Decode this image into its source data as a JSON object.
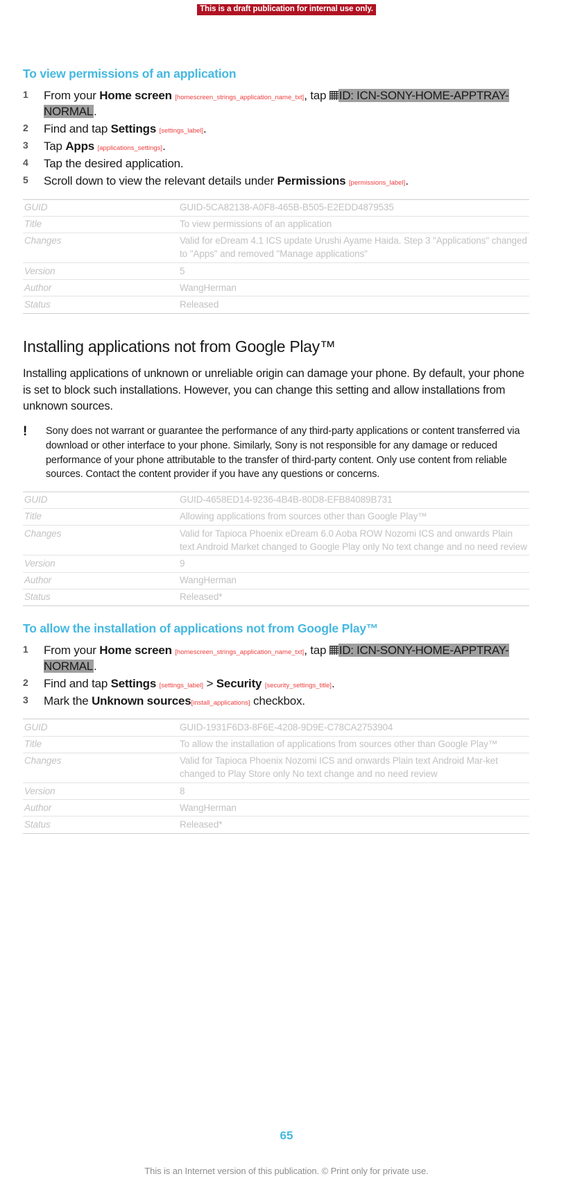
{
  "banner": {
    "draft_notice": "This is a draft publication for internal use only."
  },
  "sections": [
    {
      "heading": "To view permissions of an application",
      "steps": [
        {
          "num": "1",
          "prefix": "From your ",
          "bold1": "Home screen",
          "strid1": "[homescreen_strings_application_name_txt]",
          "mid": ", tap ",
          "icon": "grid-icon",
          "icn_text": "ID: ICN-SONY-HOME-APPTRAY-NORMAL",
          "suffix": "."
        },
        {
          "num": "2",
          "prefix": "Find and tap ",
          "bold1": "Settings",
          "strid1": "[settings_label]",
          "suffix": "."
        },
        {
          "num": "3",
          "prefix": "Tap ",
          "bold1": "Apps",
          "strid1": "[applications_settings]",
          "suffix": "."
        },
        {
          "num": "4",
          "prefix": "Tap the desired application.",
          "bold1": "",
          "strid1": "",
          "suffix": ""
        },
        {
          "num": "5",
          "prefix": "Scroll down to view the relevant details under ",
          "bold1": "Permissions",
          "strid1": "[permissions_label]",
          "suffix": "."
        }
      ],
      "table": {
        "rows": [
          {
            "key": "GUID",
            "value": "GUID-5CA82138-A0F8-465B-B505-E2EDD4879535"
          },
          {
            "key": "Title",
            "value": "To view permissions of an application"
          },
          {
            "key": "Changes",
            "value": "Valid for eDream 4.1 ICS update Urushi Ayame Haida. Step 3 \"Applications\" changed to \"Apps\" and removed \"Manage applications\""
          },
          {
            "key": "Version",
            "value": "5"
          },
          {
            "key": "Author",
            "value": "WangHerman"
          },
          {
            "key": "Status",
            "value": "Released"
          }
        ]
      }
    },
    {
      "main_heading": "Installing applications not from Google Play™",
      "paragraph": "Installing applications of unknown or unreliable origin can damage your phone. By default, your phone is set to block such installations. However, you can change this setting and allow installations from unknown sources.",
      "note": {
        "icon": "exclamation-icon",
        "text": "Sony does not warrant or guarantee the performance of any third-party applications or content transferred via download or other interface to your phone. Similarly, Sony is not responsible for any damage or reduced performance of your phone attributable to the transfer of third-party content. Only use content from reliable sources. Contact the content provider if you have any questions or concerns."
      },
      "table": {
        "rows": [
          {
            "key": "GUID",
            "value": "GUID-4658ED14-9236-4B4B-80D8-EFB84089B731"
          },
          {
            "key": "Title",
            "value": "Allowing applications from sources other than Google Play™"
          },
          {
            "key": "Changes",
            "value": "Valid for Tapioca Phoenix eDream 6.0 Aoba ROW Nozomi ICS and onwards Plain text Android Market changed to Google Play only No text change and no need review"
          },
          {
            "key": "Version",
            "value": "9"
          },
          {
            "key": "Author",
            "value": "WangHerman"
          },
          {
            "key": "Status",
            "value": "Released*"
          }
        ]
      }
    },
    {
      "heading": "To allow the installation of applications not from Google Play™",
      "steps": [
        {
          "num": "1",
          "prefix": "From your ",
          "bold1": "Home screen",
          "strid1": "[homescreen_strings_application_name_txt]",
          "mid": ", tap ",
          "icon": "grid-icon",
          "icn_text": "ID: ICN-SONY-HOME-APPTRAY-NORMAL",
          "suffix": "."
        },
        {
          "num": "2",
          "prefix": "Find and tap ",
          "bold1": "Settings",
          "strid1": "[settings_label]",
          "mid": " > ",
          "bold2": "Security",
          "strid2": "[security_settings_title]",
          "suffix": "."
        },
        {
          "num": "3",
          "prefix": "Mark the ",
          "bold1": "Unknown sources",
          "strid1": "[install_applications]",
          "suffix": " checkbox."
        }
      ],
      "table": {
        "rows": [
          {
            "key": "GUID",
            "value": "GUID-1931F6D3-8F6E-4208-9D9E-C78CA2753904"
          },
          {
            "key": "Title",
            "value": "To allow the installation of applications from sources other than Google Play™"
          },
          {
            "key": "Changes",
            "value": "Valid for Tapioca Phoenix Nozomi ICS and onwards Plain text Android Mar-ket changed to Play Store only No text change and no need review"
          },
          {
            "key": "Version",
            "value": "8"
          },
          {
            "key": "Author",
            "value": "WangHerman"
          },
          {
            "key": "Status",
            "value": "Released*"
          }
        ]
      }
    }
  ],
  "footer": {
    "page_number": "65",
    "notice": "This is an Internet version of this publication. © Print only for private use."
  },
  "colors": {
    "heading_blue": "#45b8e0",
    "draft_red": "#b01222",
    "string_id_red": "#ef3e3e",
    "table_text_gray": "#c2c2c2",
    "icn_highlight_gray": "#9e9e9e"
  }
}
